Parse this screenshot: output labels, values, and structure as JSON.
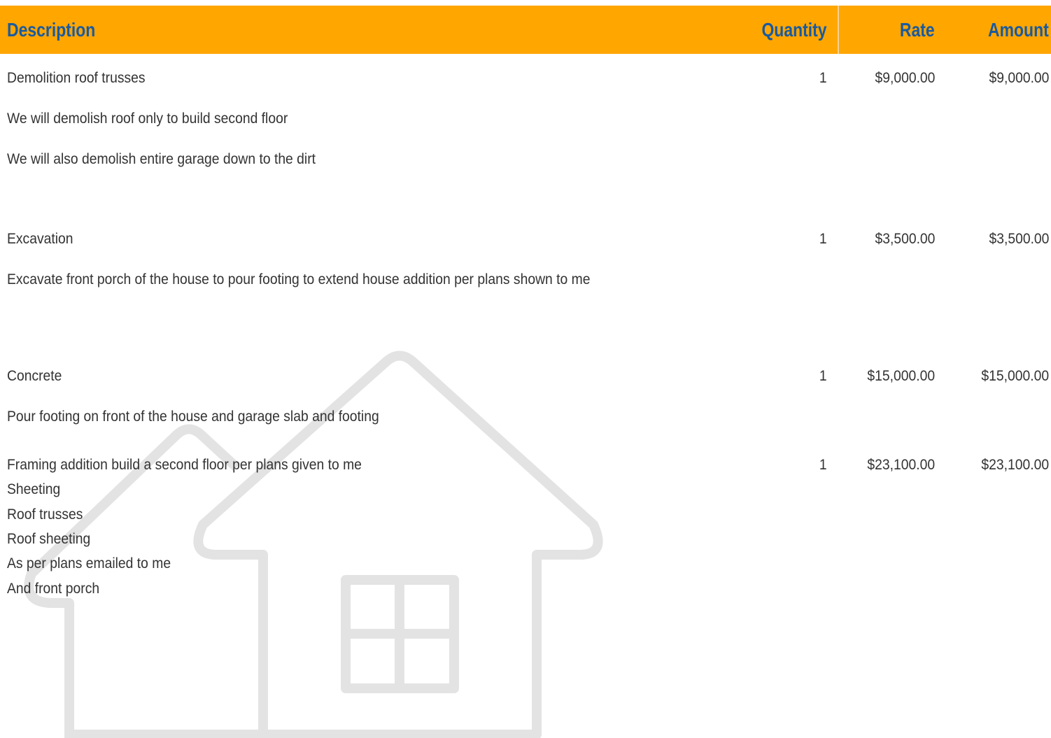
{
  "table": {
    "header": {
      "description": "Description",
      "quantity": "Quantity",
      "rate": "Rate",
      "amount": "Amount"
    },
    "items": [
      {
        "lines": [
          "Demolition roof trusses",
          "We will demolish roof only to build second floor",
          "We will also demolish entire garage down to the dirt"
        ],
        "quantity": "1",
        "rate": "$9,000.00",
        "amount": "$9,000.00"
      },
      {
        "lines": [
          "Excavation",
          "Excavate front porch of the house to pour footing to extend house addition per plans shown to me"
        ],
        "quantity": "1",
        "rate": "$3,500.00",
        "amount": "$3,500.00"
      },
      {
        "lines": [
          "Concrete",
          "Pour footing on front of the house and garage slab and footing"
        ],
        "quantity": "1",
        "rate": "$15,000.00",
        "amount": "$15,000.00"
      },
      {
        "lines": [
          "Framing addition build a second floor per plans given to me",
          "Sheeting",
          "Roof trusses",
          "Roof sheeting",
          "As per plans emailed to me",
          "And front porch"
        ],
        "quantity": "1",
        "rate": "$23,100.00",
        "amount": "$23,100.00"
      }
    ]
  },
  "colors": {
    "header_bg": "#FFA600",
    "header_text": "#1a5a9e",
    "body_text": "#333333",
    "watermark": "#e3e3e3"
  },
  "watermark": {
    "icon": "house-icon"
  }
}
